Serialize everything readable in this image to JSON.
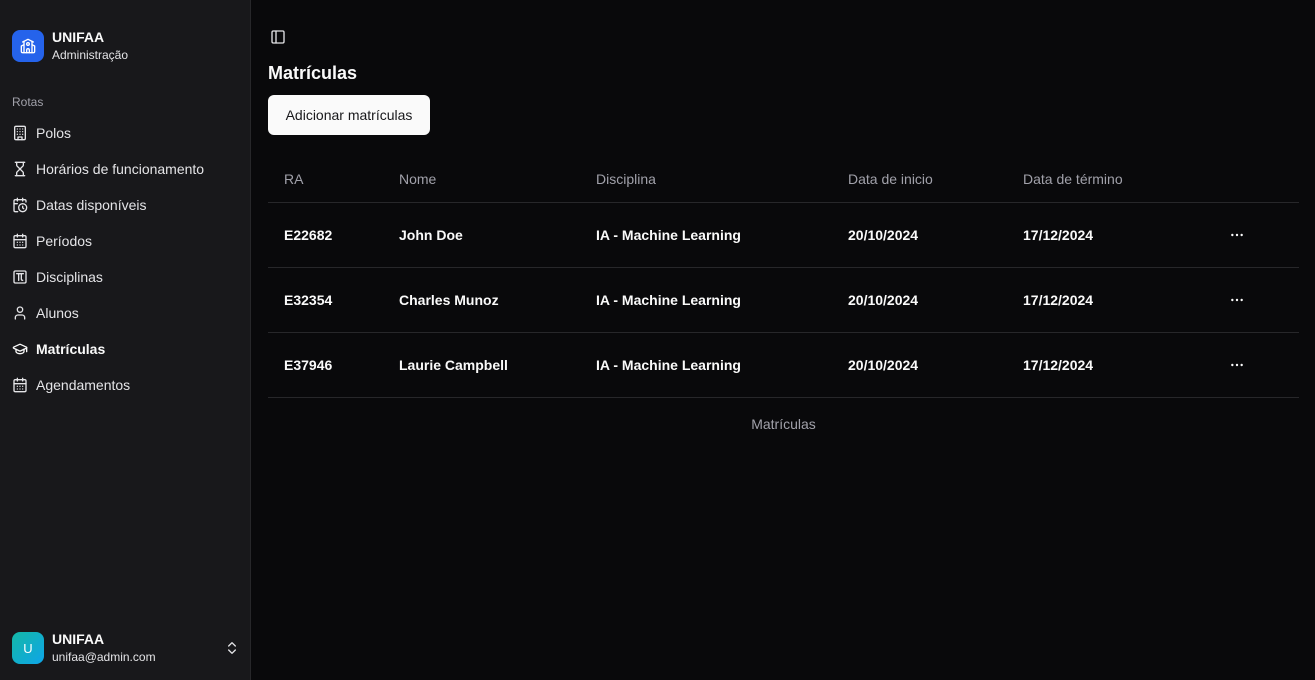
{
  "sidebar": {
    "brand_name": "UNIFAA",
    "brand_sub": "Administração",
    "group_label": "Rotas",
    "items": [
      {
        "label": "Polos",
        "icon": "building-icon"
      },
      {
        "label": "Horários de funcionamento",
        "icon": "hourglass-icon"
      },
      {
        "label": "Datas disponíveis",
        "icon": "calendar-clock-icon"
      },
      {
        "label": "Períodos",
        "icon": "calendar-days-icon"
      },
      {
        "label": "Disciplinas",
        "icon": "square-pi-icon"
      },
      {
        "label": "Alunos",
        "icon": "user-icon"
      },
      {
        "label": "Matrículas",
        "icon": "graduation-cap-icon",
        "active": true
      },
      {
        "label": "Agendamentos",
        "icon": "calendar-icon"
      }
    ],
    "user": {
      "initial": "U",
      "name": "UNIFAA",
      "email": "unifaa@admin.com"
    }
  },
  "main": {
    "title": "Matrículas",
    "add_button": "Adicionar matrículas",
    "columns": [
      "RA",
      "Nome",
      "Disciplina",
      "Data de inicio",
      "Data de término"
    ],
    "rows": [
      [
        "E22682",
        "John Doe",
        "IA - Machine Learning",
        "20/10/2024",
        "17/12/2024"
      ],
      [
        "E32354",
        "Charles Munoz",
        "IA - Machine Learning",
        "20/10/2024",
        "17/12/2024"
      ],
      [
        "E37946",
        "Laurie Campbell",
        "IA - Machine Learning",
        "20/10/2024",
        "17/12/2024"
      ]
    ],
    "caption": "Matrículas"
  },
  "colors": {
    "background": "#09090b",
    "sidebar": "#18181b",
    "brand": "#2563eb",
    "border": "#27272a",
    "muted": "#a1a1aa"
  }
}
